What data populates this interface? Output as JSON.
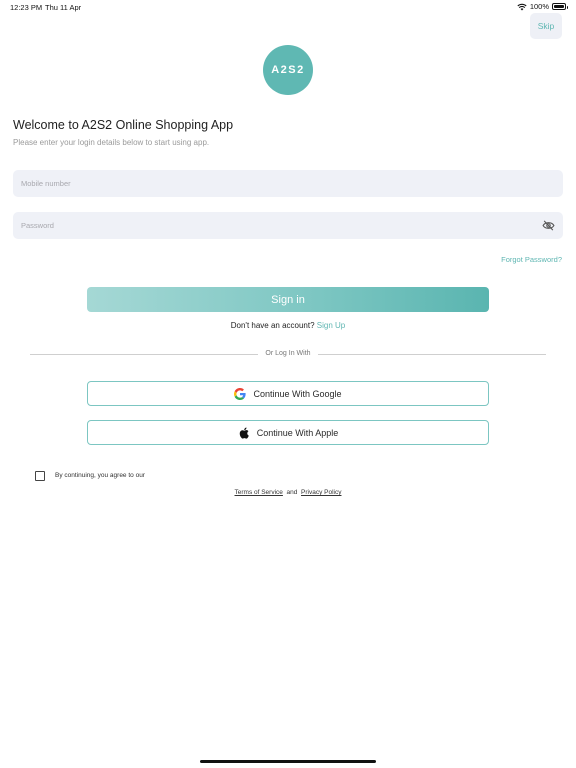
{
  "status_bar": {
    "time": "12:23 PM",
    "date": "Thu 11 Apr",
    "battery": "100%",
    "battery_level": 1.0
  },
  "header": {
    "skip_label": "Skip"
  },
  "logo": {
    "text": "A2S2",
    "color": "#5fb8b3"
  },
  "welcome": {
    "title": "Welcome to A2S2 Online Shopping App",
    "subtitle": "Please enter your login details below to start using app."
  },
  "form": {
    "mobile": {
      "placeholder": "Mobile number",
      "value": ""
    },
    "password": {
      "placeholder": "Password",
      "value": ""
    },
    "password_toggle_icon": "eye-off-icon",
    "forgot_label": "Forgot Password?",
    "signin_label": "Sign in",
    "no_account_text": "Don't have an account?",
    "signup_label": "Sign Up"
  },
  "divider": {
    "text": "Or Log In With"
  },
  "social": {
    "google": {
      "label": "Continue With Google",
      "icon": "google-icon"
    },
    "apple": {
      "label": "Continue With Apple",
      "icon": "apple-icon"
    }
  },
  "agreement": {
    "checked": false,
    "text": "By continuing, you agree to our",
    "terms_label": "Terms of Service",
    "and_text": "and",
    "privacy_label": "Privacy Policy"
  },
  "colors": {
    "accent": "#5fb6b2",
    "input_bg": "#eff1f7",
    "border_accent": "#7cc6c2"
  }
}
